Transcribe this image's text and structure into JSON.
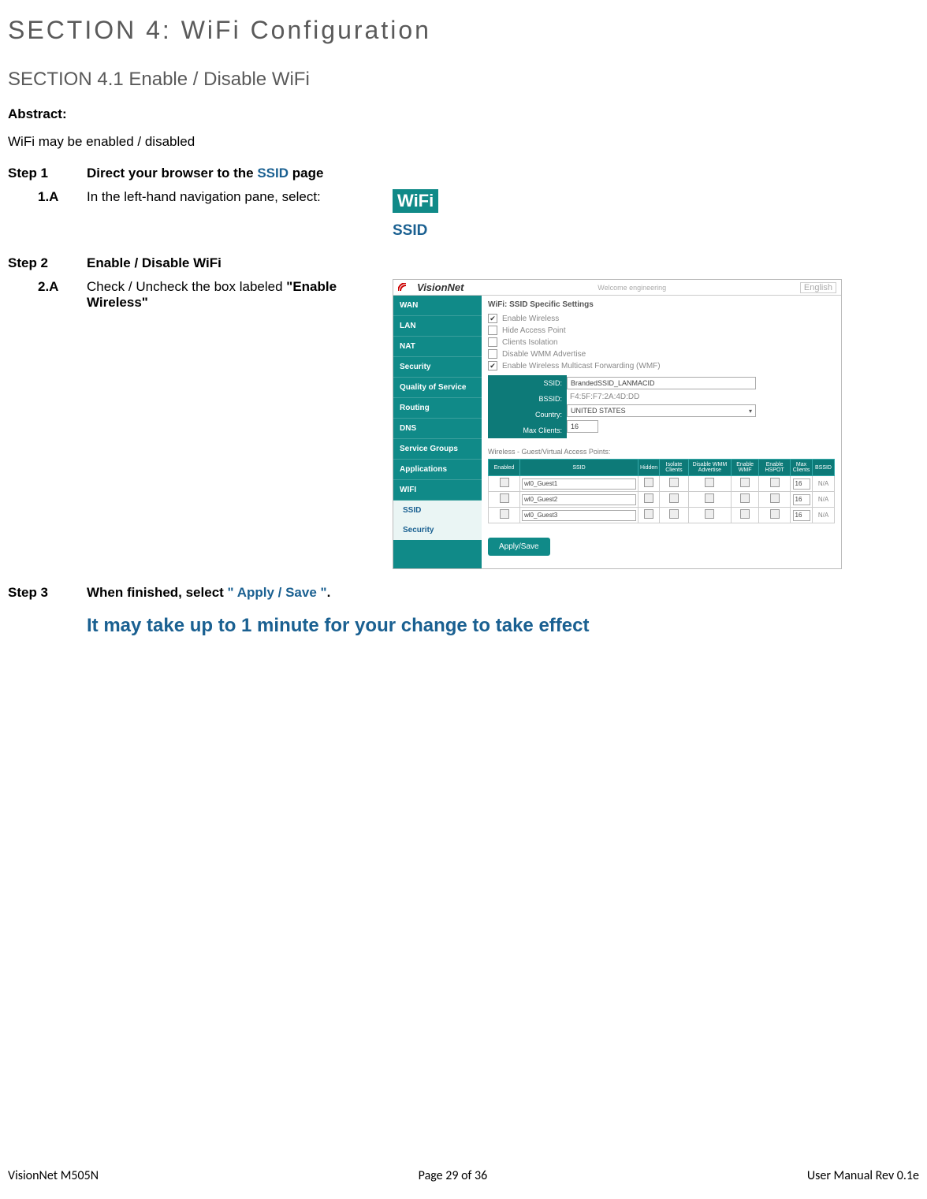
{
  "section_title": "SECTION  4:  WiFi  Configuration",
  "subsection_title": "SECTION 4.1 Enable / Disable WiFi",
  "abstract_label": "Abstract:",
  "abstract_text": "WiFi may be enabled / disabled",
  "step1": {
    "label": "Step 1",
    "text_a": "Direct your browser to the ",
    "text_link": "SSID",
    "text_b": " page"
  },
  "step1a": {
    "label": "1.A",
    "text": "In the left-hand navigation pane, select:",
    "wifi": "WiFi",
    "ssid": "SSID"
  },
  "step2": {
    "label": "Step 2",
    "text": "Enable / Disable WiFi"
  },
  "step2a": {
    "label": "2.A",
    "text_a": "Check / Uncheck the box labeled ",
    "text_b": "\"Enable Wireless\""
  },
  "shot": {
    "brand": "VisionNet",
    "welcome": "Welcome  engineering",
    "lang": "English",
    "nav": [
      "WAN",
      "LAN",
      "NAT",
      "Security",
      "Quality of Service",
      "Routing",
      "DNS",
      "Service Groups",
      "Applications",
      "WIFI"
    ],
    "subnav": [
      "SSID",
      "Security"
    ],
    "main_title": "WiFi: SSID Specific Settings",
    "checks": [
      {
        "label": "Enable Wireless",
        "on": true
      },
      {
        "label": "Hide Access Point",
        "on": false
      },
      {
        "label": "Clients Isolation",
        "on": false
      },
      {
        "label": "Disable WMM Advertise",
        "on": false
      },
      {
        "label": "Enable Wireless Multicast Forwarding (WMF)",
        "on": true
      }
    ],
    "fields_labels": [
      "SSID:",
      "BSSID:",
      "Country:",
      "Max Clients:"
    ],
    "fields_values": {
      "ssid": "BrandedSSID_LANMACID",
      "bssid": "F4:5F:F7:2A:4D:DD",
      "country": "UNITED STATES",
      "max": "16"
    },
    "vap_title": "Wireless - Guest/Virtual Access Points:",
    "tbl_head": [
      "Enabled",
      "SSID",
      "Hidden",
      "Isolate Clients",
      "Disable WMM Advertise",
      "Enable WMF",
      "Enable HSPOT",
      "Max Clients",
      "BSSID"
    ],
    "rows": [
      {
        "ssid": "wl0_Guest1",
        "max": "16",
        "bssid": "N/A"
      },
      {
        "ssid": "wl0_Guest2",
        "max": "16",
        "bssid": "N/A"
      },
      {
        "ssid": "wl0_Guest3",
        "max": "16",
        "bssid": "N/A"
      }
    ],
    "apply": "Apply/Save"
  },
  "step3": {
    "label": "Step 3",
    "text_a": "When finished, select ",
    "text_link": "\" Apply / Save \"",
    "text_b": "."
  },
  "effect_note": "It may take up to 1 minute for your change to take effect",
  "footer": {
    "left": "VisionNet   M505N",
    "mid": "Page 29 of 36",
    "right": "User Manual Rev 0.1e"
  },
  "chart_data": {
    "type": "table",
    "title": "Wireless - Guest/Virtual Access Points",
    "columns": [
      "Enabled",
      "SSID",
      "Hidden",
      "Isolate Clients",
      "Disable WMM Advertise",
      "Enable WMF",
      "Enable HSPOT",
      "Max Clients",
      "BSSID"
    ],
    "rows": [
      [
        false,
        "wl0_Guest1",
        false,
        false,
        false,
        false,
        false,
        16,
        "N/A"
      ],
      [
        false,
        "wl0_Guest2",
        false,
        false,
        false,
        false,
        false,
        16,
        "N/A"
      ],
      [
        false,
        "wl0_Guest3",
        false,
        false,
        false,
        false,
        false,
        16,
        "N/A"
      ]
    ]
  }
}
